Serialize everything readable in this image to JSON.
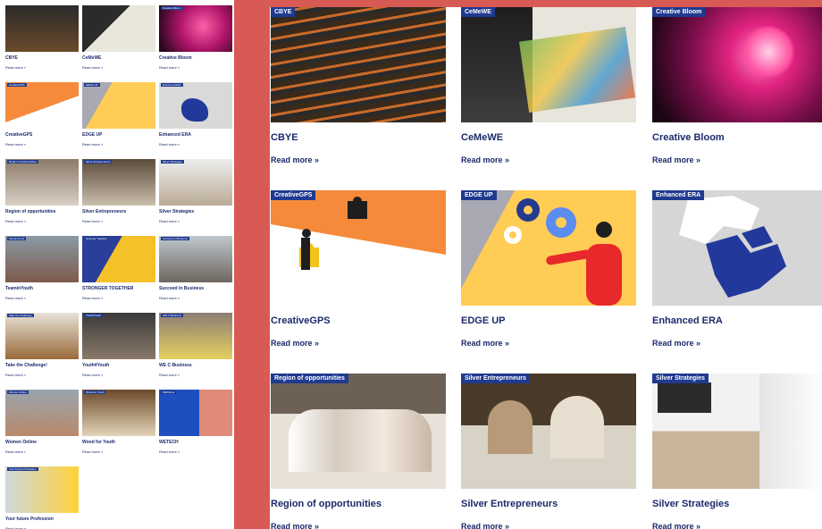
{
  "read_more": "Read more »",
  "left_items": [
    {
      "title": "CBYE",
      "tag": ""
    },
    {
      "title": "CeMeWE",
      "tag": ""
    },
    {
      "title": "Creative Bloom",
      "tag": "Creative Bloom"
    },
    {
      "title": "CreativeGPS",
      "tag": "CreativeGPS"
    },
    {
      "title": "EDGE UP",
      "tag": "EDGE UP"
    },
    {
      "title": "Enhanced ERA",
      "tag": "Enhanced ERA"
    },
    {
      "title": "Region of opportunities",
      "tag": "Region of opportunities"
    },
    {
      "title": "Silver Entrepreneurs",
      "tag": "Silver Entrepreneurs"
    },
    {
      "title": "Silver Strategies",
      "tag": "Silver Strategies"
    },
    {
      "title": "TeaminYouth",
      "tag": "TeaminYouth"
    },
    {
      "title": "STRONGER TOGETHER",
      "tag": "Stronger Together"
    },
    {
      "title": "Succeed in Business",
      "tag": "Succeed in Business"
    },
    {
      "title": "Take the Challenge!",
      "tag": "Take the Challenge"
    },
    {
      "title": "Youth4Youth",
      "tag": "Youth4Youth"
    },
    {
      "title": "WE C Business",
      "tag": "WE C Business"
    },
    {
      "title": "Women Online",
      "tag": "Women Online"
    },
    {
      "title": "Wood for Youth",
      "tag": "Wood for Youth"
    },
    {
      "title": "WETECH",
      "tag": "WETECH"
    },
    {
      "title": "Your future Profession",
      "tag": "Your Future Profession"
    }
  ],
  "cards": [
    {
      "badge": "CBYE",
      "title": "CBYE",
      "icon": "audience-photo"
    },
    {
      "badge": "CeMeWE",
      "title": "CeMeWE",
      "icon": "board-game-photo"
    },
    {
      "badge": "Creative Bloom",
      "title": "Creative Bloom",
      "icon": "flower-head-art"
    },
    {
      "badge": "CreativeGPS",
      "title": "CreativeGPS",
      "icon": "puzzle-illustration"
    },
    {
      "badge": "EDGE UP",
      "title": "EDGE UP",
      "icon": "gears-illustration"
    },
    {
      "badge": "Enhanced ERA",
      "title": "Enhanced ERA",
      "icon": "map-illustration"
    },
    {
      "badge": "Region of opportunities",
      "title": "Region of opportunities",
      "icon": "team-photo"
    },
    {
      "badge": "Silver Entrepreneurs",
      "title": "Silver Entrepreneurs",
      "icon": "seniors-photo"
    },
    {
      "badge": "Silver Strategies",
      "title": "Silver Strategies",
      "icon": "meeting-photo"
    }
  ]
}
